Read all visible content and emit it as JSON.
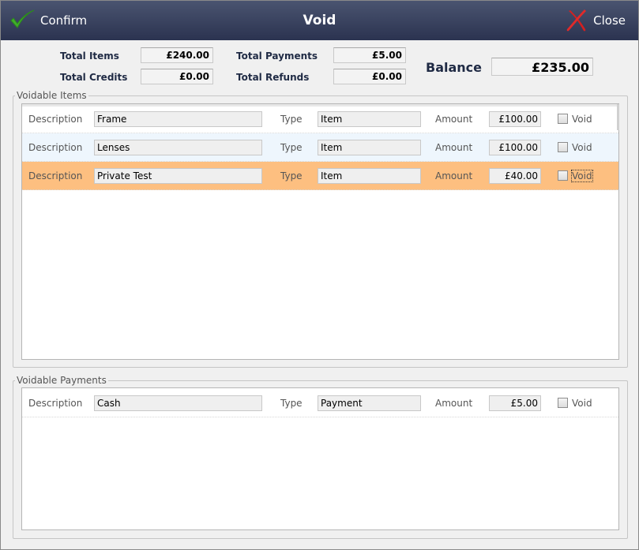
{
  "titlebar": {
    "confirm_label": "Confirm",
    "title": "Void",
    "close_label": "Close"
  },
  "summary": {
    "total_items_label": "Total Items",
    "total_items_value": "£240.00",
    "total_credits_label": "Total Credits",
    "total_credits_value": "£0.00",
    "total_payments_label": "Total Payments",
    "total_payments_value": "£5.00",
    "total_refunds_label": "Total Refunds",
    "total_refunds_value": "£0.00",
    "balance_label": "Balance",
    "balance_value": "£235.00"
  },
  "voidable_items": {
    "legend": "Voidable Items",
    "rows": [
      {
        "desc_label": "Description",
        "desc": "Frame",
        "type_label": "Type",
        "type": "Item",
        "amount_label": "Amount",
        "amount": "£100.00",
        "void_label": "Void",
        "checked": false
      },
      {
        "desc_label": "Description",
        "desc": "Lenses",
        "type_label": "Type",
        "type": "Item",
        "amount_label": "Amount",
        "amount": "£100.00",
        "void_label": "Void",
        "checked": false
      },
      {
        "desc_label": "Description",
        "desc": "Private Test",
        "type_label": "Type",
        "type": "Item",
        "amount_label": "Amount",
        "amount": "£40.00",
        "void_label": "Void",
        "checked": false
      }
    ]
  },
  "voidable_payments": {
    "legend": "Voidable Payments",
    "rows": [
      {
        "desc_label": "Description",
        "desc": "Cash",
        "type_label": "Type",
        "type": "Payment",
        "amount_label": "Amount",
        "amount": "£5.00",
        "void_label": "Void",
        "checked": false
      }
    ]
  },
  "colors": {
    "titlebar": "#2b3350",
    "selected_row": "#fdbf80",
    "alt_row": "#eef6fd",
    "confirm_icon": "#3fae2a",
    "close_icon": "#d42020"
  },
  "icons": {
    "confirm": "checkmark-icon",
    "close": "close-icon"
  }
}
